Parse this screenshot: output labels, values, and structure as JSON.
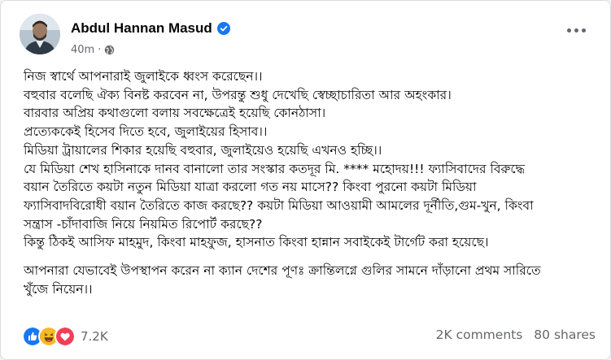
{
  "author": {
    "name": "Abdul Hannan Masud",
    "verified_icon": "verified-badge-icon"
  },
  "meta": {
    "time": "40m",
    "separator": "·",
    "audience_icon": "globe-icon"
  },
  "post": {
    "lines": [
      "নিজ স্বার্থে আপনারাই জুলাইকে ধ্বংস করেছেন।।",
      "বহুবার বলেছি ঐক্য বিনষ্ট করবেন না, উপরন্তু শুধু দেখেছি স্বেচ্ছাচারিতা আর অহংকার।",
      "বারবার অপ্রিয় কথাগুলো বলায় সবক্ষেত্রেই হয়েছি কোনঠাসা।",
      "প্রত্যেককেই হিসেব দিতে হবে, জুলাইয়ের হিসাব।।",
      "মিডিয়া ট্রায়ালের শিকার হয়েছি বহুবার, জুলাইয়েও হয়েছি এখনও হচ্ছি।।",
      "যে মিডিয়া শেখ হাসিনাকে দানব বানালো তার সংস্কার কতদূর মি. **** মহোদয়!!! ফ্যাসিবাদের বিরুদ্ধে",
      "বয়ান তৈরিতে কয়টা নতুন মিডিয়া যাত্রা করলো গত নয় মাসে?? কিংবা পুরনো কয়টা মিডিয়া",
      "ফ্যাসিবাদবিরোধী বয়ান তৈরিতে কাজ করছে?? কয়টা মিডিয়া আওয়ামী আমলের দূর্নীতি,গুম-খুন, কিংবা",
      "সন্ত্রাস -চাঁদাবাজি নিয়ে নিয়মিত রিপোর্ট করছে??",
      "কিন্তু ঠিকই আসিফ মাহমুদ, কিংবা মাহফুজ, হাসনাত কিংবা হান্নান সবাইকেই টার্গেট করা হয়েছে।"
    ],
    "closing_lines": [
      "আপনারা যেভাবেই উপস্থাপন করেন না ক্যান দেশের পূণঃ ক্রান্তিলগ্নে গুলির সামনে দাঁড়ানো প্রথম সারিতে",
      "খুঁজে নিয়েন।।"
    ]
  },
  "reactions": {
    "icons": [
      "like-icon",
      "haha-icon",
      "love-icon"
    ],
    "count": "7.2K"
  },
  "stats": {
    "comments": "2K comments",
    "shares": "80 shares"
  },
  "colors": {
    "like": "#1877f2",
    "love": "#f33e58",
    "haha": "#f7b928",
    "verified": "#1877f2"
  }
}
